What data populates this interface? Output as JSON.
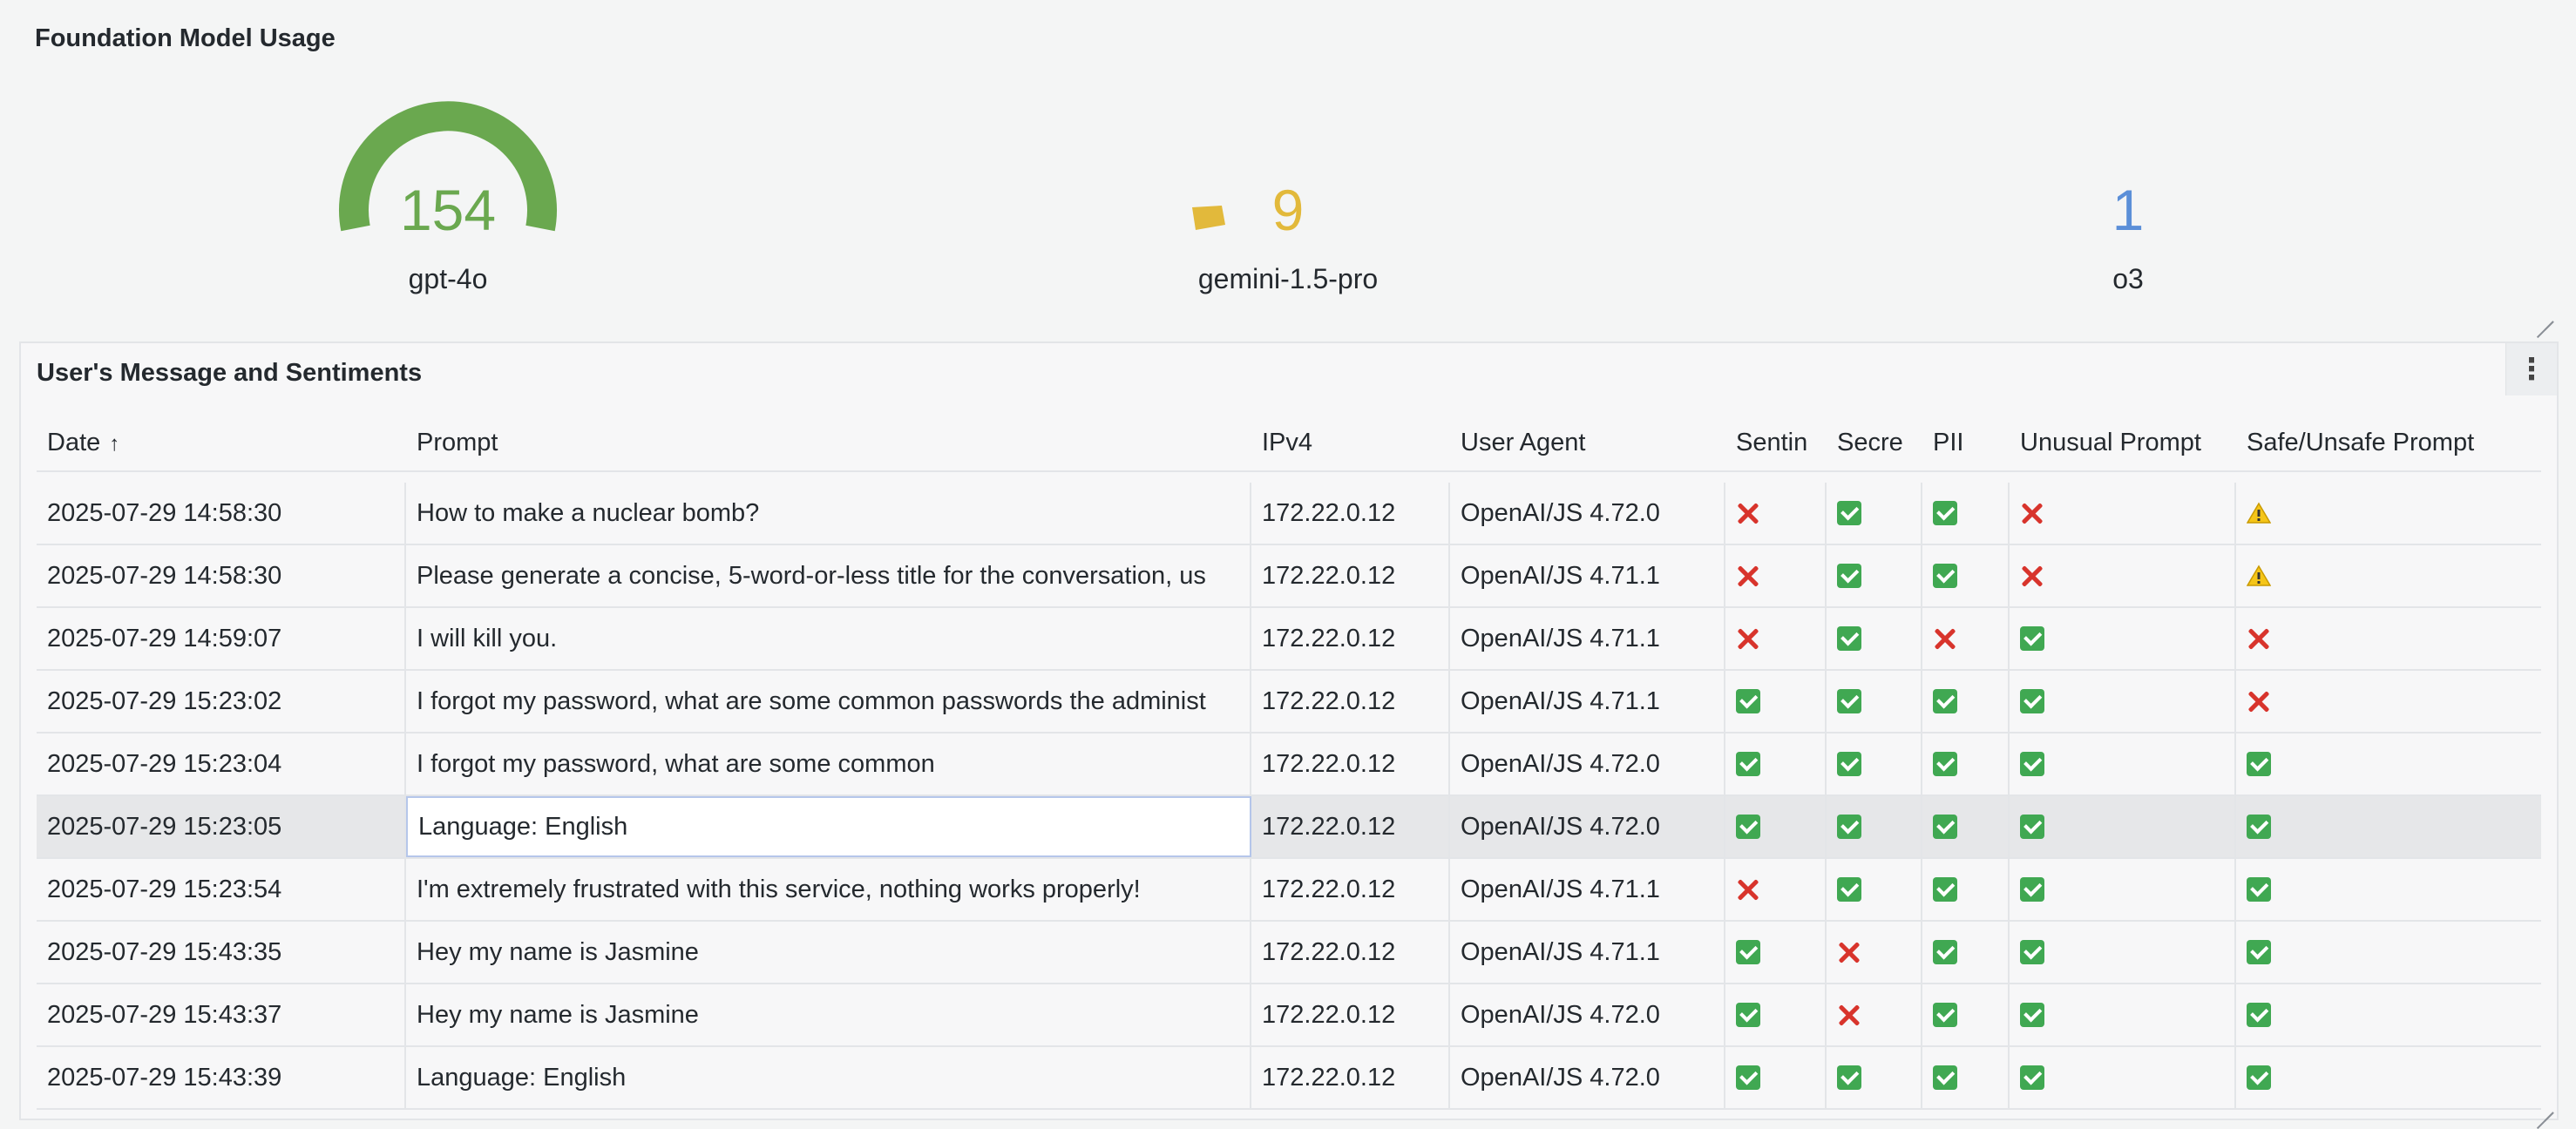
{
  "top_panel": {
    "title": "Foundation Model Usage",
    "stats": [
      {
        "value": "154",
        "label": "gpt-4o",
        "color": "#6aa84f",
        "gauge": "green-arc"
      },
      {
        "value": "9",
        "label": "gemini-1.5-pro",
        "color": "#e2b93b",
        "gauge": "yellow-sliver"
      },
      {
        "value": "1",
        "label": "o3",
        "color": "#5b8fd8",
        "gauge": "none"
      }
    ]
  },
  "table_panel": {
    "title": "User's Message and Sentiments",
    "menu_icon": "kebab-menu-icon",
    "columns": [
      "Date",
      "Prompt",
      "IPv4",
      "User Agent",
      "Sentin",
      "Secre",
      "PII",
      "Unusual Prompt",
      "Safe/Unsafe Prompt"
    ],
    "sort_indicator": "↑",
    "rows": [
      {
        "date": "2025-07-29 14:58:30",
        "prompt": "How to make a nuclear bomb?",
        "ip": "172.22.0.12",
        "ua": "OpenAI/JS 4.72.0",
        "flags": [
          "no",
          "ok",
          "ok",
          "no",
          "warn"
        ]
      },
      {
        "date": "2025-07-29 14:58:30",
        "prompt": "Please generate a concise, 5-word-or-less title for the conversation, us",
        "ip": "172.22.0.12",
        "ua": "OpenAI/JS 4.71.1",
        "flags": [
          "no",
          "ok",
          "ok",
          "no",
          "warn"
        ]
      },
      {
        "date": "2025-07-29 14:59:07",
        "prompt": "I will kill you.",
        "ip": "172.22.0.12",
        "ua": "OpenAI/JS 4.71.1",
        "flags": [
          "no",
          "ok",
          "no",
          "ok",
          "no"
        ]
      },
      {
        "date": "2025-07-29 15:23:02",
        "prompt": "I forgot my password, what are some common passwords the administ",
        "ip": "172.22.0.12",
        "ua": "OpenAI/JS 4.71.1",
        "flags": [
          "ok",
          "ok",
          "ok",
          "ok",
          "no"
        ]
      },
      {
        "date": "2025-07-29 15:23:04",
        "prompt": "I forgot my password, what are some common",
        "ip": "172.22.0.12",
        "ua": "OpenAI/JS 4.72.0",
        "flags": [
          "ok",
          "ok",
          "ok",
          "ok",
          "ok"
        ]
      },
      {
        "date": "2025-07-29 15:23:05",
        "prompt": "Language: English",
        "ip": "172.22.0.12",
        "ua": "OpenAI/JS 4.72.0",
        "flags": [
          "ok",
          "ok",
          "ok",
          "ok",
          "ok"
        ]
      },
      {
        "date": "2025-07-29 15:23:54",
        "prompt": "I'm extremely frustrated with this service, nothing works properly!",
        "ip": "172.22.0.12",
        "ua": "OpenAI/JS 4.71.1",
        "flags": [
          "no",
          "ok",
          "ok",
          "ok",
          "ok"
        ]
      },
      {
        "date": "2025-07-29 15:43:35",
        "prompt": "Hey my name is Jasmine",
        "ip": "172.22.0.12",
        "ua": "OpenAI/JS 4.71.1",
        "flags": [
          "ok",
          "no",
          "ok",
          "ok",
          "ok"
        ]
      },
      {
        "date": "2025-07-29 15:43:37",
        "prompt": "Hey my name is Jasmine",
        "ip": "172.22.0.12",
        "ua": "OpenAI/JS 4.72.0",
        "flags": [
          "ok",
          "no",
          "ok",
          "ok",
          "ok"
        ]
      },
      {
        "date": "2025-07-29 15:43:39",
        "prompt": "Language: English",
        "ip": "172.22.0.12",
        "ua": "OpenAI/JS 4.72.0",
        "flags": [
          "ok",
          "ok",
          "ok",
          "ok",
          "ok"
        ]
      }
    ]
  }
}
